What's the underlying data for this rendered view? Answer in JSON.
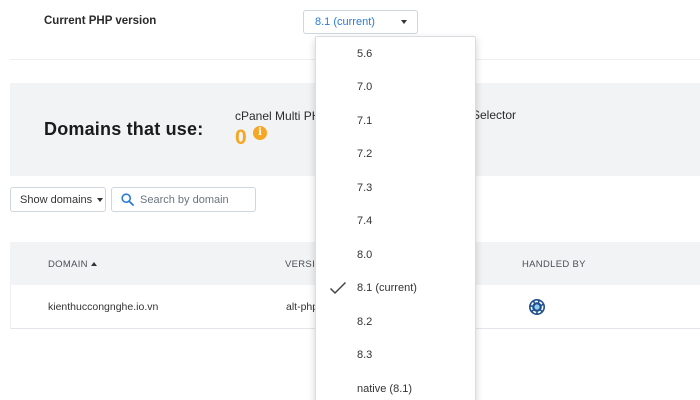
{
  "php_version": {
    "label": "Current PHP version",
    "selected": "8.1 (current)"
  },
  "domains_panel": {
    "title": "Domains that use:",
    "subtitle_left": "cPanel Multi PH",
    "subtitle_right": "Selector",
    "count": "0"
  },
  "toolbar": {
    "show_domains_label": "Show domains",
    "search_placeholder": "Search by domain"
  },
  "table": {
    "headers": {
      "domain": "DOMAIN",
      "version": "VERSIO",
      "handled_by": "HANDLED BY"
    },
    "rows": [
      {
        "domain": "kienthuccongnghe.io.vn",
        "version": "alt-php",
        "handler_icon": "cloudlinux-icon"
      }
    ]
  },
  "dropdown": {
    "options": [
      "5.6",
      "7.0",
      "7.1",
      "7.2",
      "7.3",
      "7.4",
      "8.0",
      "8.1 (current)",
      "8.2",
      "8.3",
      "native (8.1)"
    ],
    "checked_option": "8.1 (current)"
  },
  "colors": {
    "accent_blue": "#2b7bd6",
    "count_orange": "#f5a623",
    "panel_gray": "#f2f3f5"
  }
}
